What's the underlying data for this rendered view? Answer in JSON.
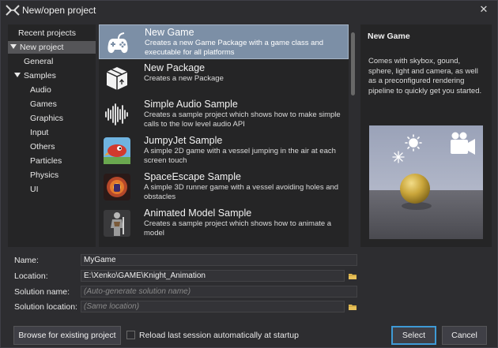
{
  "window": {
    "title": "New/open project",
    "close_glyph": "✕",
    "logo_icon": "xenko-logo-icon"
  },
  "categories": [
    {
      "label": "Recent projects",
      "expanded": false,
      "selected": false
    },
    {
      "label": "New project",
      "expanded": true,
      "selected": true
    },
    {
      "label": "General",
      "selected": false
    },
    {
      "label": "Samples",
      "expanded": true,
      "selected": false
    },
    {
      "label": "Audio",
      "selected": false
    },
    {
      "label": "Games",
      "selected": false
    },
    {
      "label": "Graphics",
      "selected": false
    },
    {
      "label": "Input",
      "selected": false
    },
    {
      "label": "Others",
      "selected": false
    },
    {
      "label": "Particles",
      "selected": false
    },
    {
      "label": "Physics",
      "selected": false
    },
    {
      "label": "UI",
      "selected": false
    }
  ],
  "templates": [
    {
      "name": "New Game",
      "description": "Creates a new Game Package with a game class and executable for all platforms",
      "icon": "gamepad-icon",
      "selected": true
    },
    {
      "name": "New Package",
      "description": "Creates a new Package",
      "icon": "package-box-icon",
      "selected": false
    },
    {
      "name": "Simple Audio Sample",
      "description": "Creates a sample project which shows how to make simple calls to the low level audio API",
      "icon": "audio-waveform-icon",
      "selected": false
    },
    {
      "name": "JumpyJet Sample",
      "description": "A simple 2D game with a vessel jumping in the air at each screen touch",
      "icon": "jumpyjet-thumbnail-icon",
      "selected": false
    },
    {
      "name": "SpaceEscape Sample",
      "description": "A simple 3D runner game with a vessel avoiding holes and obstacles",
      "icon": "spaceescape-thumbnail-icon",
      "selected": false
    },
    {
      "name": "Animated Model Sample",
      "description": "Creates a sample project which shows how to animate a model",
      "icon": "animated-knight-thumbnail-icon",
      "selected": false
    }
  ],
  "details": {
    "title": "New Game",
    "description": "Comes with skybox, gound, sphere, light and camera, as well as a preconfigured rendering pipeline to quickly get you started.",
    "preview_icon": "scene-preview-icon"
  },
  "form": {
    "name_label": "Name:",
    "name_value": "MyGame",
    "location_label": "Location:",
    "location_value": "E:\\Xenko\\GAME\\Knight_Animation",
    "solution_name_label": "Solution name:",
    "solution_name_placeholder": "(Auto-generate solution name)",
    "solution_location_label": "Solution location:",
    "solution_location_placeholder": "(Same location)"
  },
  "footer": {
    "browse_label": "Browse for existing project",
    "reload_label": "Reload last session automatically at startup",
    "reload_checked": false,
    "select_label": "Select",
    "cancel_label": "Cancel"
  },
  "colors": {
    "accent": "#3e9ad6",
    "selected_item": "#7c8fa6",
    "folder": "#e8c15a"
  }
}
